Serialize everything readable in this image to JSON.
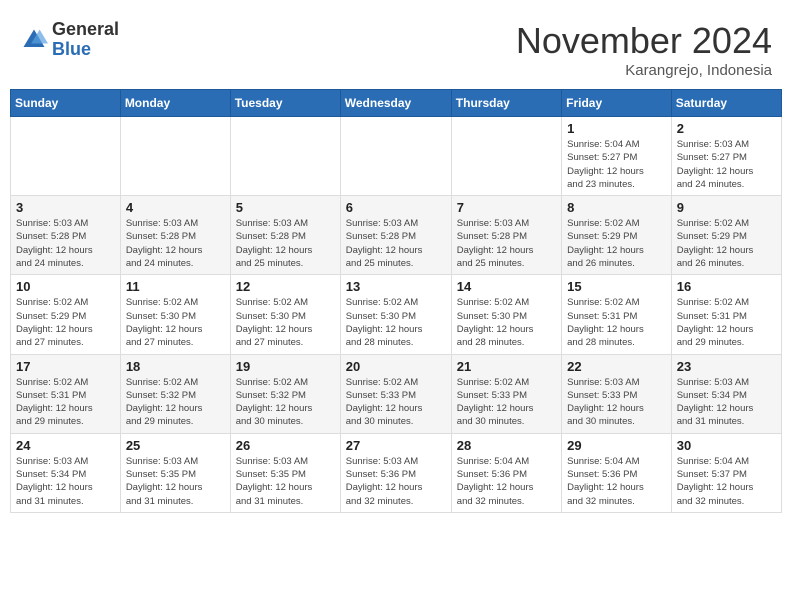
{
  "header": {
    "logo_general": "General",
    "logo_blue": "Blue",
    "month_title": "November 2024",
    "location": "Karangrejo, Indonesia"
  },
  "days_of_week": [
    "Sunday",
    "Monday",
    "Tuesday",
    "Wednesday",
    "Thursday",
    "Friday",
    "Saturday"
  ],
  "weeks": [
    [
      {
        "day": "",
        "info": ""
      },
      {
        "day": "",
        "info": ""
      },
      {
        "day": "",
        "info": ""
      },
      {
        "day": "",
        "info": ""
      },
      {
        "day": "",
        "info": ""
      },
      {
        "day": "1",
        "info": "Sunrise: 5:04 AM\nSunset: 5:27 PM\nDaylight: 12 hours\nand 23 minutes."
      },
      {
        "day": "2",
        "info": "Sunrise: 5:03 AM\nSunset: 5:27 PM\nDaylight: 12 hours\nand 24 minutes."
      }
    ],
    [
      {
        "day": "3",
        "info": "Sunrise: 5:03 AM\nSunset: 5:28 PM\nDaylight: 12 hours\nand 24 minutes."
      },
      {
        "day": "4",
        "info": "Sunrise: 5:03 AM\nSunset: 5:28 PM\nDaylight: 12 hours\nand 24 minutes."
      },
      {
        "day": "5",
        "info": "Sunrise: 5:03 AM\nSunset: 5:28 PM\nDaylight: 12 hours\nand 25 minutes."
      },
      {
        "day": "6",
        "info": "Sunrise: 5:03 AM\nSunset: 5:28 PM\nDaylight: 12 hours\nand 25 minutes."
      },
      {
        "day": "7",
        "info": "Sunrise: 5:03 AM\nSunset: 5:28 PM\nDaylight: 12 hours\nand 25 minutes."
      },
      {
        "day": "8",
        "info": "Sunrise: 5:02 AM\nSunset: 5:29 PM\nDaylight: 12 hours\nand 26 minutes."
      },
      {
        "day": "9",
        "info": "Sunrise: 5:02 AM\nSunset: 5:29 PM\nDaylight: 12 hours\nand 26 minutes."
      }
    ],
    [
      {
        "day": "10",
        "info": "Sunrise: 5:02 AM\nSunset: 5:29 PM\nDaylight: 12 hours\nand 27 minutes."
      },
      {
        "day": "11",
        "info": "Sunrise: 5:02 AM\nSunset: 5:30 PM\nDaylight: 12 hours\nand 27 minutes."
      },
      {
        "day": "12",
        "info": "Sunrise: 5:02 AM\nSunset: 5:30 PM\nDaylight: 12 hours\nand 27 minutes."
      },
      {
        "day": "13",
        "info": "Sunrise: 5:02 AM\nSunset: 5:30 PM\nDaylight: 12 hours\nand 28 minutes."
      },
      {
        "day": "14",
        "info": "Sunrise: 5:02 AM\nSunset: 5:30 PM\nDaylight: 12 hours\nand 28 minutes."
      },
      {
        "day": "15",
        "info": "Sunrise: 5:02 AM\nSunset: 5:31 PM\nDaylight: 12 hours\nand 28 minutes."
      },
      {
        "day": "16",
        "info": "Sunrise: 5:02 AM\nSunset: 5:31 PM\nDaylight: 12 hours\nand 29 minutes."
      }
    ],
    [
      {
        "day": "17",
        "info": "Sunrise: 5:02 AM\nSunset: 5:31 PM\nDaylight: 12 hours\nand 29 minutes."
      },
      {
        "day": "18",
        "info": "Sunrise: 5:02 AM\nSunset: 5:32 PM\nDaylight: 12 hours\nand 29 minutes."
      },
      {
        "day": "19",
        "info": "Sunrise: 5:02 AM\nSunset: 5:32 PM\nDaylight: 12 hours\nand 30 minutes."
      },
      {
        "day": "20",
        "info": "Sunrise: 5:02 AM\nSunset: 5:33 PM\nDaylight: 12 hours\nand 30 minutes."
      },
      {
        "day": "21",
        "info": "Sunrise: 5:02 AM\nSunset: 5:33 PM\nDaylight: 12 hours\nand 30 minutes."
      },
      {
        "day": "22",
        "info": "Sunrise: 5:03 AM\nSunset: 5:33 PM\nDaylight: 12 hours\nand 30 minutes."
      },
      {
        "day": "23",
        "info": "Sunrise: 5:03 AM\nSunset: 5:34 PM\nDaylight: 12 hours\nand 31 minutes."
      }
    ],
    [
      {
        "day": "24",
        "info": "Sunrise: 5:03 AM\nSunset: 5:34 PM\nDaylight: 12 hours\nand 31 minutes."
      },
      {
        "day": "25",
        "info": "Sunrise: 5:03 AM\nSunset: 5:35 PM\nDaylight: 12 hours\nand 31 minutes."
      },
      {
        "day": "26",
        "info": "Sunrise: 5:03 AM\nSunset: 5:35 PM\nDaylight: 12 hours\nand 31 minutes."
      },
      {
        "day": "27",
        "info": "Sunrise: 5:03 AM\nSunset: 5:36 PM\nDaylight: 12 hours\nand 32 minutes."
      },
      {
        "day": "28",
        "info": "Sunrise: 5:04 AM\nSunset: 5:36 PM\nDaylight: 12 hours\nand 32 minutes."
      },
      {
        "day": "29",
        "info": "Sunrise: 5:04 AM\nSunset: 5:36 PM\nDaylight: 12 hours\nand 32 minutes."
      },
      {
        "day": "30",
        "info": "Sunrise: 5:04 AM\nSunset: 5:37 PM\nDaylight: 12 hours\nand 32 minutes."
      }
    ]
  ]
}
